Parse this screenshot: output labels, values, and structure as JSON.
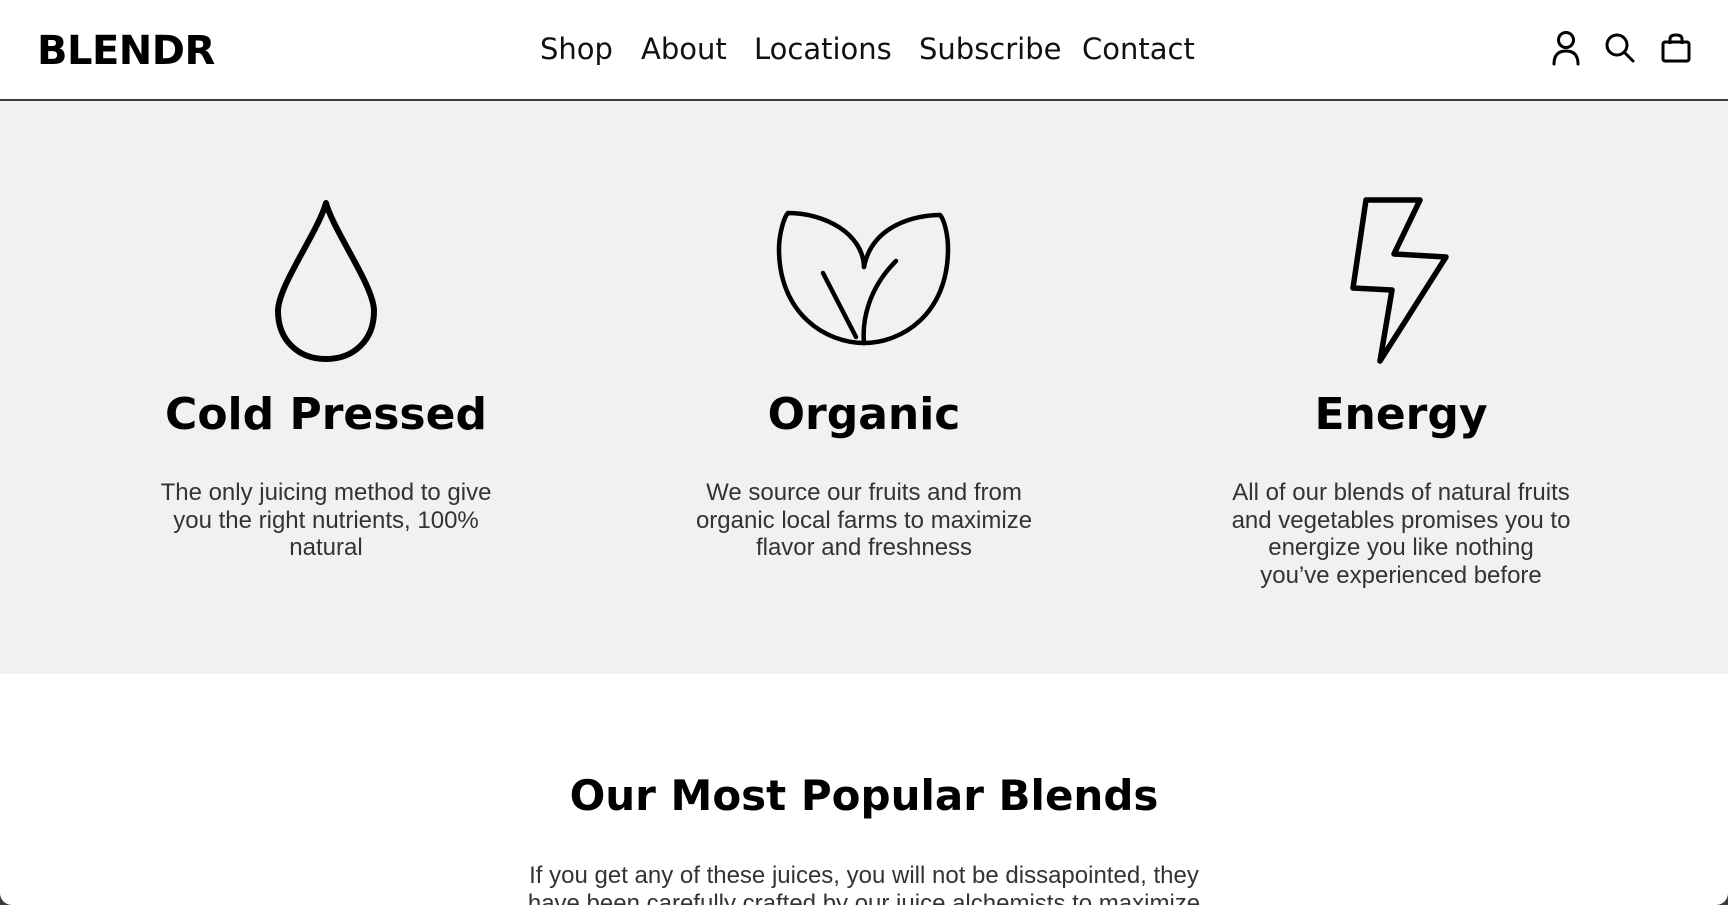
{
  "header": {
    "logo": "BLENDR",
    "nav": [
      "Shop",
      "About",
      "Locations",
      "Subscribe",
      "Contact"
    ],
    "icons": [
      "account-icon",
      "search-icon",
      "shopping-bag-icon"
    ]
  },
  "features": [
    {
      "icon": "water-drop-icon",
      "title": "Cold Pressed",
      "text": "The only juicing method to give you the right nutrients, 100% natural"
    },
    {
      "icon": "leaves-icon",
      "title": "Organic",
      "text": "We source our fruits and from organic local farms to maximize flavor and freshness"
    },
    {
      "icon": "lightning-icon",
      "title": "Energy",
      "text": "All of our blends of natural fruits and vegetables promises you to energize you like nothing you’ve experienced before"
    }
  ],
  "popular": {
    "title": "Our Most Popular Blends",
    "text": "If you get any of these juices, you will not be dissapointed, they have been carefully crafted by our juice alchemists to maximize"
  },
  "colors": {
    "features_bg": "#f1f1f1",
    "text": "#000000",
    "body_text": "#333333"
  }
}
